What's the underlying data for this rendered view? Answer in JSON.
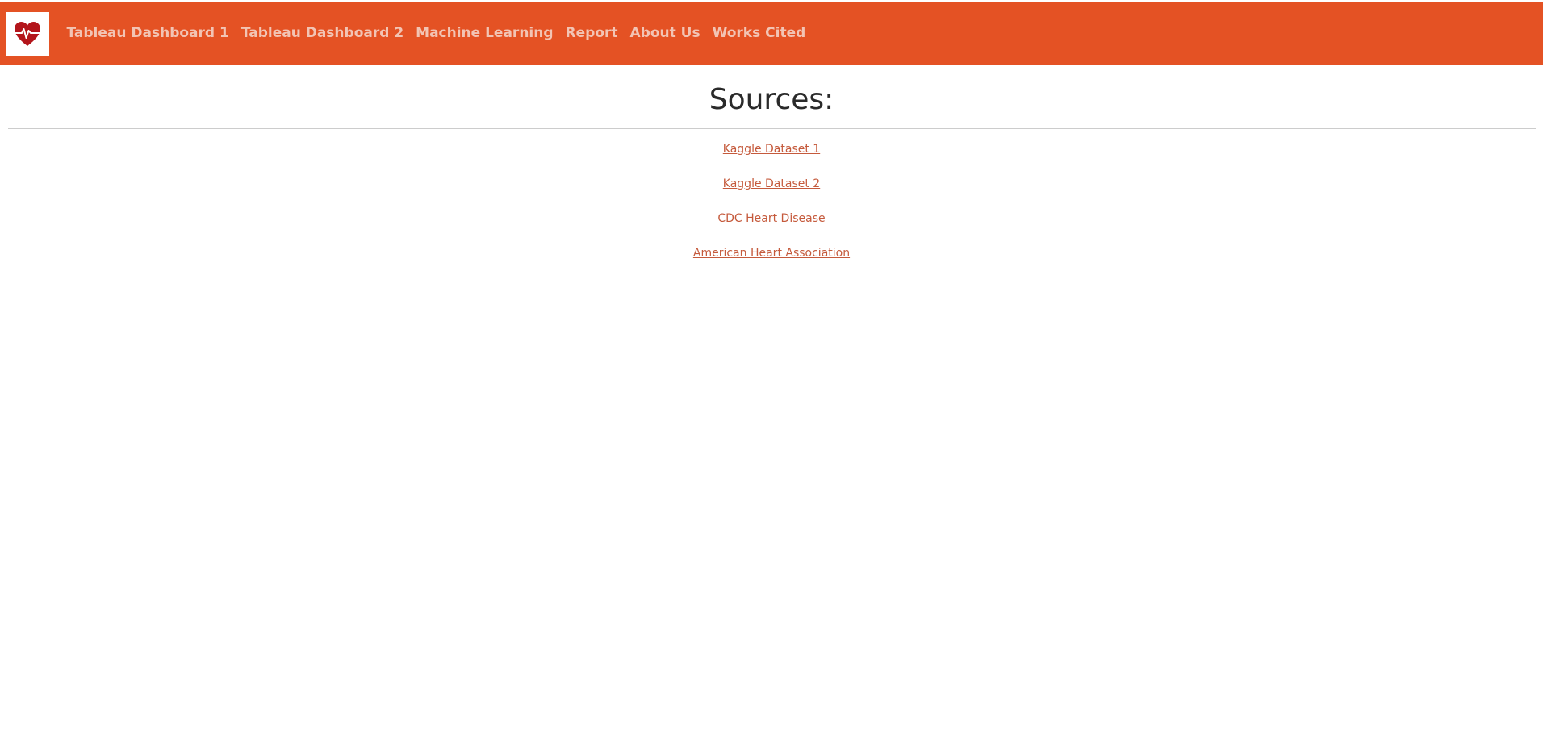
{
  "nav": {
    "brand_icon": "heart-pulse-icon",
    "accent_color": "#e45224",
    "items": [
      {
        "label": "Tableau Dashboard 1"
      },
      {
        "label": "Tableau Dashboard 2"
      },
      {
        "label": "Machine Learning"
      },
      {
        "label": "Report"
      },
      {
        "label": "About Us"
      },
      {
        "label": "Works Cited"
      }
    ]
  },
  "main": {
    "title": "Sources:",
    "links": [
      {
        "label": "Kaggle Dataset 1"
      },
      {
        "label": "Kaggle Dataset 2"
      },
      {
        "label": "CDC Heart Disease"
      },
      {
        "label": "American Heart Association"
      }
    ]
  }
}
